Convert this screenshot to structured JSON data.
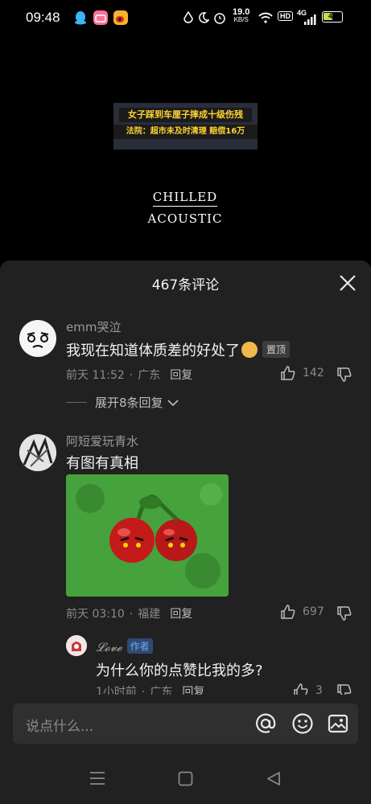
{
  "status_bar": {
    "time": "09:48",
    "net_speed_value": "19.0",
    "net_speed_unit": "KB/S",
    "hd": "HD",
    "network": "4G",
    "battery": "46"
  },
  "video": {
    "caption_line1": "女子踩到车厘子摔成十级伤残",
    "caption_line2": "法院：超市未及时清理 赔偿16万",
    "title_line1": "CHILLED",
    "title_line2": "ACOUSTIC"
  },
  "comments_panel": {
    "title": "467条评论",
    "comments": [
      {
        "username": "emm哭泣",
        "text": "我现在知道体质差的好处了",
        "emoji": "doge-emoji",
        "pin_label": "置顶",
        "time": "前天 11:52",
        "location": "广东",
        "reply_label": "回复",
        "likes": "142",
        "expand_label": "展开8条回复"
      },
      {
        "username": "阿短爱玩青水",
        "text": "有图有真相",
        "image": "cherry-bomb-image",
        "time": "前天 03:10",
        "location": "福建",
        "reply_label": "回复",
        "likes": "697"
      }
    ],
    "reply": {
      "username": "𝓛𝓸𝓿𝓮",
      "author_tag": "作者",
      "text": "为什么你的点赞比我的多?",
      "time": "1小时前",
      "location": "广东",
      "reply_label": "回复",
      "likes": "3"
    },
    "input_placeholder": "说点什么..."
  }
}
